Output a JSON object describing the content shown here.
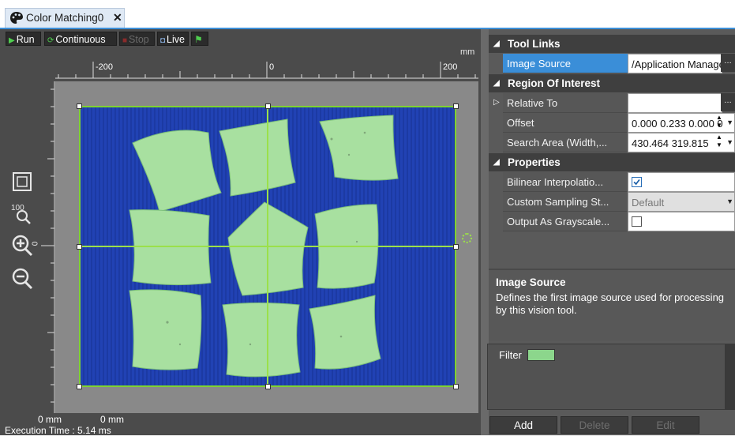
{
  "tab": {
    "title": "Color Matching0",
    "close_glyph": "✕"
  },
  "toolbar": {
    "run": "Run",
    "continuous": "Continuous",
    "stop": "Stop",
    "live": "Live"
  },
  "ruler": {
    "unit": "mm",
    "h_labels": [
      "-200",
      "0",
      "200"
    ],
    "v_label": "0"
  },
  "status": {
    "coord_x": "0 mm",
    "coord_y": "0 mm",
    "execution_time": "Execution Time : 5.14 ms"
  },
  "property_grid": {
    "categories": [
      {
        "label": "Tool Links",
        "rows": [
          {
            "name": "Image Source",
            "value": "/Application Manager"
          }
        ]
      },
      {
        "label": "Region Of Interest",
        "rows": [
          {
            "name": "Relative To",
            "value": ""
          },
          {
            "name": "Offset",
            "value": "0.000 0.233 0.000 0"
          },
          {
            "name": "Search Area (Width,...",
            "value": "430.464 319.815"
          }
        ]
      },
      {
        "label": "Properties",
        "rows": [
          {
            "name": "Bilinear Interpolatio...",
            "value": "checked"
          },
          {
            "name": "Custom Sampling St...",
            "value": "Default"
          },
          {
            "name": "Output As Grayscale...",
            "value": "unchecked"
          }
        ]
      }
    ]
  },
  "help": {
    "title": "Image Source",
    "text": "Defines the first image source used for processing by this vision tool."
  },
  "filter": {
    "label": "Filter",
    "swatch_color": "#8cd68c"
  },
  "actions": {
    "add": "Add",
    "delete": "Delete",
    "edit": "Edit"
  },
  "colors": {
    "accent": "#3a8ed8",
    "roi": "#7fd330",
    "background": "#2142b4",
    "pillow": "#a8e0a0"
  }
}
